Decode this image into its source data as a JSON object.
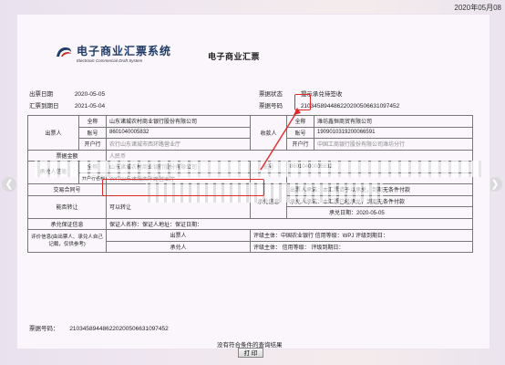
{
  "date_stamp": "2020年05月08",
  "logo": {
    "cn_text": "电子商业汇票系统",
    "en_text": "Electronic Commercial Draft System"
  },
  "title": "电子商业汇票",
  "meta": {
    "issue_date_label": "出票日期",
    "issue_date": "2020-05-05",
    "due_date_label": "汇票到期日",
    "due_date": "2021-05-04",
    "status_label": "票据状态",
    "status": "提示承兑待签收",
    "number_label": "票据号码",
    "number": "210345894486220200506631097452"
  },
  "table": {
    "drawer_side": "出票人",
    "payee_side": "收款人",
    "full_name_label": "全称",
    "account_label": "账号",
    "bank_label": "开户行",
    "drawer_name": "山东诸城农村商业银行股份有限公司",
    "drawer_account": "8601040005832",
    "drawer_bank": "农行山东诸城市西环路营业厅",
    "payee_name": "潍坊鑫恒商贸有限公司",
    "payee_account": "1909010319200066591",
    "payee_bank": "中国工商银行股份有限公司潍坊分行",
    "amount_label": "票据金额",
    "amount_value": "人民币",
    "acceptor_label": "承兑人信息",
    "acceptor_name": "山东诸城农村商业银行股份有限公司",
    "acceptor_account": "86010400005832",
    "acceptor_bank_label": "开户行名称",
    "acceptor_bank": "农行山东诸城西环路营业厅",
    "contract_label": "交易合同号",
    "transfer_label": "能否转让",
    "transfer_value": "可以转让",
    "acceptance_info_label": "承兑信息",
    "acceptance_promise": "出票人承诺：本汇票请予以承兑，到期无条件付款",
    "acceptor_promise": "承兑人承诺：本汇票已经承兑，到期无条件付款",
    "acceptance_date": "承兑日期：2020-05-05",
    "guarantee_label": "承兑保证信息",
    "guarantee_value": "保证人名称：保证人地址：保证日期：",
    "rating_label": "评价信息(由出票人、承兑人自己记载，仅供参考)",
    "drawer_rating_label": "出票人",
    "drawer_rating": "评级主体：中国农业银行  信用等级：WPJ  评级到期日：",
    "acceptor_rating_label": "承兑人",
    "acceptor_rating": "评级主体：  信用等级：  评级到期日："
  },
  "repeat_label": "票据号码：",
  "repeat_number": "210345894486220200506631097452",
  "footer_note": "没有符合条件的查询结果",
  "print_button": "打 印",
  "nav": {
    "prev_glyph": "❮",
    "next_glyph": "❯"
  },
  "colors": {
    "highlight": "#e02a2a",
    "brand": "#1f3b66"
  }
}
